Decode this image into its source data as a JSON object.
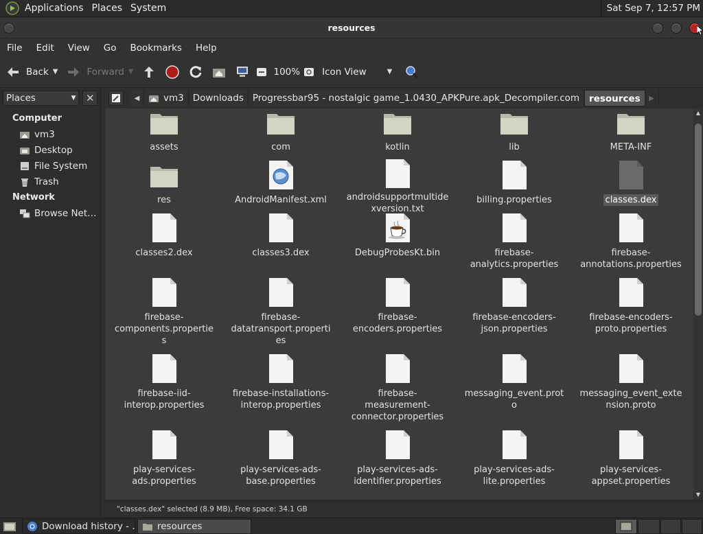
{
  "top_panel": {
    "menus": [
      "Applications",
      "Places",
      "System"
    ],
    "clock": "Sat Sep  7, 12:57 PM"
  },
  "window": {
    "title": "resources"
  },
  "menubar": [
    "File",
    "Edit",
    "View",
    "Go",
    "Bookmarks",
    "Help"
  ],
  "toolbar": {
    "back_label": "Back",
    "forward_label": "Forward",
    "zoom": "100%",
    "view_mode": "Icon View"
  },
  "sidebar": {
    "selector": "Places",
    "groups": [
      {
        "title": "Computer",
        "items": [
          {
            "label": "vm3",
            "icon": "home-folder-icon"
          },
          {
            "label": "Desktop",
            "icon": "desktop-folder-icon"
          },
          {
            "label": "File System",
            "icon": "drive-icon"
          },
          {
            "label": "Trash",
            "icon": "trash-icon"
          }
        ]
      },
      {
        "title": "Network",
        "items": [
          {
            "label": "Browse Net…",
            "icon": "network-icon"
          }
        ]
      }
    ]
  },
  "location": {
    "crumbs": [
      "vm3",
      "Downloads",
      "Progressbar95 - nostalgic game_1.0430_APKPure.apk_Decompiler.com",
      "resources"
    ]
  },
  "files": [
    {
      "name": "assets",
      "type": "folder"
    },
    {
      "name": "com",
      "type": "folder"
    },
    {
      "name": "kotlin",
      "type": "folder"
    },
    {
      "name": "lib",
      "type": "folder"
    },
    {
      "name": "META-INF",
      "type": "folder"
    },
    {
      "name": "res",
      "type": "folder"
    },
    {
      "name": "AndroidManifest.xml",
      "type": "xml"
    },
    {
      "name": "androidsupportmultidexversion.txt",
      "type": "file"
    },
    {
      "name": "billing.properties",
      "type": "file"
    },
    {
      "name": "classes.dex",
      "type": "dex",
      "selected": true
    },
    {
      "name": "classes2.dex",
      "type": "file"
    },
    {
      "name": "classes3.dex",
      "type": "file"
    },
    {
      "name": "DebugProbesKt.bin",
      "type": "java"
    },
    {
      "name": "firebase-analytics.properties",
      "type": "file"
    },
    {
      "name": "firebase-annotations.properties",
      "type": "file"
    },
    {
      "name": "firebase-components.properties",
      "type": "file"
    },
    {
      "name": "firebase-datatransport.properties",
      "type": "file"
    },
    {
      "name": "firebase-encoders.properties",
      "type": "file"
    },
    {
      "name": "firebase-encoders-json.properties",
      "type": "file"
    },
    {
      "name": "firebase-encoders-proto.properties",
      "type": "file"
    },
    {
      "name": "firebase-iid-interop.properties",
      "type": "file"
    },
    {
      "name": "firebase-installations-interop.properties",
      "type": "file"
    },
    {
      "name": "firebase-measurement-connector.properties",
      "type": "file"
    },
    {
      "name": "messaging_event.proto",
      "type": "file"
    },
    {
      "name": "messaging_event_extension.proto",
      "type": "file"
    },
    {
      "name": "play-services-ads.properties",
      "type": "file"
    },
    {
      "name": "play-services-ads-base.properties",
      "type": "file"
    },
    {
      "name": "play-services-ads-identifier.properties",
      "type": "file"
    },
    {
      "name": "play-services-ads-lite.properties",
      "type": "file"
    },
    {
      "name": "play-services-appset.properties",
      "type": "file"
    }
  ],
  "status": "\"classes.dex\" selected (8.9 MB), Free space: 34.1 GB",
  "taskbar": [
    {
      "label": "Download history - …",
      "icon": "chromium-icon",
      "active": false
    },
    {
      "label": "resources",
      "icon": "folder-icon",
      "active": true
    }
  ],
  "colors": {
    "panel": "#2b2b2b",
    "icon_view": "#3b3b3b",
    "selected": "#5a5a5a"
  }
}
